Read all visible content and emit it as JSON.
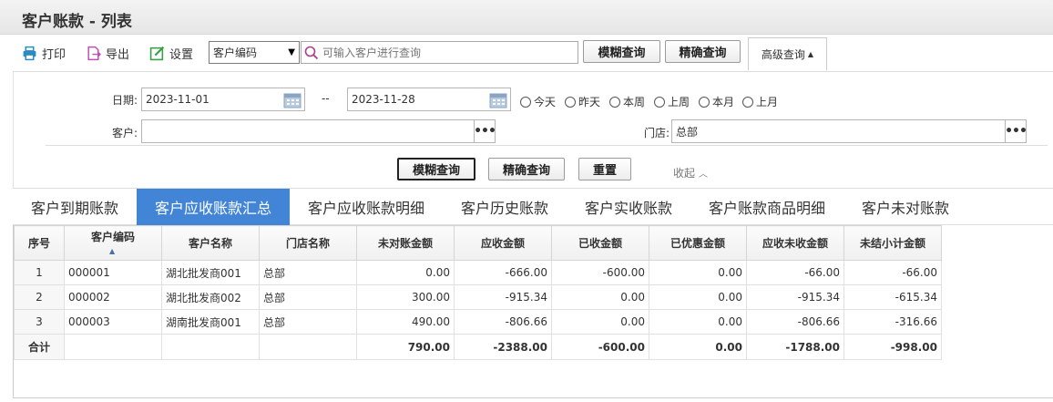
{
  "title": "客户账款 - 列表",
  "toolbar": {
    "print": "打印",
    "export": "导出",
    "settings": "设置",
    "select_value": "客户编码",
    "search_placeholder": "可输入客户进行查询",
    "fuzzy_query": "模糊查询",
    "exact_query": "精确查询",
    "advanced_query": "高级查询"
  },
  "filter": {
    "date_label": "日期:",
    "date_from": "2023-11-01",
    "date_sep": "--",
    "date_to": "2023-11-28",
    "quick_dates": [
      "今天",
      "昨天",
      "本周",
      "上周",
      "本月",
      "上月"
    ],
    "customer_label": "客户:",
    "customer_value": "",
    "store_label": "门店:",
    "store_value": "总部",
    "fuzzy_query": "模糊查询",
    "exact_query": "精确查询",
    "reset": "重置",
    "collapse": "收起"
  },
  "tabs": [
    "客户到期账款",
    "客户应收账款汇总",
    "客户应收账款明细",
    "客户历史账款",
    "客户实收账款",
    "客户账款商品明细",
    "客户未对账款"
  ],
  "active_tab": 1,
  "table": {
    "headers": [
      "序号",
      "客户编码",
      "客户名称",
      "门店名称",
      "未对账金额",
      "应收金额",
      "已收金额",
      "已优惠金额",
      "应收未收金额",
      "未结小计金额"
    ],
    "rows": [
      [
        "1",
        "000001",
        "湖北批发商001",
        "总部",
        "0.00",
        "-666.00",
        "-600.00",
        "0.00",
        "-66.00",
        "-66.00"
      ],
      [
        "2",
        "000002",
        "湖北批发商002",
        "总部",
        "300.00",
        "-915.34",
        "0.00",
        "0.00",
        "-915.34",
        "-615.34"
      ],
      [
        "3",
        "000003",
        "湖南批发商001",
        "总部",
        "490.00",
        "-806.66",
        "0.00",
        "0.00",
        "-806.66",
        "-316.66"
      ]
    ],
    "total": [
      "合计",
      "",
      "",
      "",
      "790.00",
      "-2388.00",
      "-600.00",
      "0.00",
      "-1788.00",
      "-998.00"
    ]
  }
}
